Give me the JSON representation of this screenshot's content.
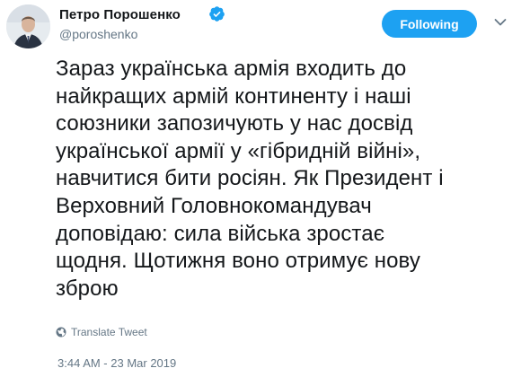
{
  "author": {
    "name": "Петро Порошенко",
    "handle": "@poroshenko",
    "verified": true
  },
  "follow_button": {
    "label": "Following"
  },
  "tweet": {
    "text": "Зараз українська армія входить до\nнайкращих армій континенту і наші\nсоюзники запозичують у нас досвід\nукраїнської армії у «гібридній війні»,\nнавчитися бити росіян. Як Президент і\nВерховний Головнокомандувач\nдоповідаю: сила війська зростає\nщодня. Щотижня воно отримує нову\nзброю"
  },
  "translate": {
    "label": "Translate Tweet"
  },
  "timestamp": "3:44 AM - 23 Mar 2019",
  "colors": {
    "accent": "#1da1f2",
    "secondary_text": "#657786",
    "primary_text": "#14171a"
  },
  "icons": {
    "verified": "verified-badge-icon",
    "chevron": "chevron-down-icon",
    "translate": "globe-icon"
  }
}
